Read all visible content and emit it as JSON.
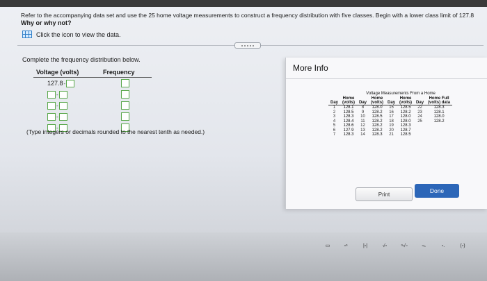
{
  "question": {
    "line1": "Refer to the accompanying data set and use the 25 home voltage measurements to construct a frequency distribution with five classes. Begin with a lower class limit of 127.8",
    "line2": "Why or why not?"
  },
  "data_link": {
    "label": "Click the icon to view the data."
  },
  "instruction": "Complete the frequency distribution below.",
  "freq_table": {
    "headers": {
      "voltage": "Voltage (volts)",
      "frequency": "Frequency"
    },
    "first_lower_limit": "127.8",
    "dash": "-"
  },
  "hint": "(Type integers or decimals rounded to the nearest tenth as needed.)",
  "modal": {
    "title": "More Info",
    "table_caption": "Voltage Measurements From a Home",
    "col_headers_top": [
      "",
      "Home",
      "",
      "Home",
      "",
      "Home",
      "",
      "Home Full"
    ],
    "col_headers": [
      "Day",
      "(volts)",
      "Day",
      "(volts)",
      "Day",
      "(volts)",
      "Day",
      "(volts) data"
    ],
    "rows": [
      [
        "1",
        "128.1",
        "8",
        "128.0",
        "15",
        "128.5",
        "22",
        "128.3"
      ],
      [
        "2",
        "128.5",
        "9",
        "128.2",
        "16",
        "128.2",
        "23",
        "128.1"
      ],
      [
        "3",
        "128.3",
        "10",
        "128.5",
        "17",
        "128.0",
        "24",
        "128.0"
      ],
      [
        "4",
        "128.4",
        "11",
        "128.2",
        "18",
        "128.0",
        "25",
        "128.2"
      ],
      [
        "5",
        "128.6",
        "12",
        "128.2",
        "19",
        "128.3",
        "",
        ""
      ],
      [
        "6",
        "127.9",
        "13",
        "128.2",
        "20",
        "128.7",
        "",
        ""
      ],
      [
        "7",
        "128.3",
        "14",
        "128.3",
        "21",
        "128.5",
        "",
        ""
      ]
    ],
    "print_label": "Print",
    "done_label": "Done"
  },
  "colors": {
    "done_button": "#2c66b8",
    "input_border": "#59a84a",
    "data_icon": "#2f7ec8"
  }
}
